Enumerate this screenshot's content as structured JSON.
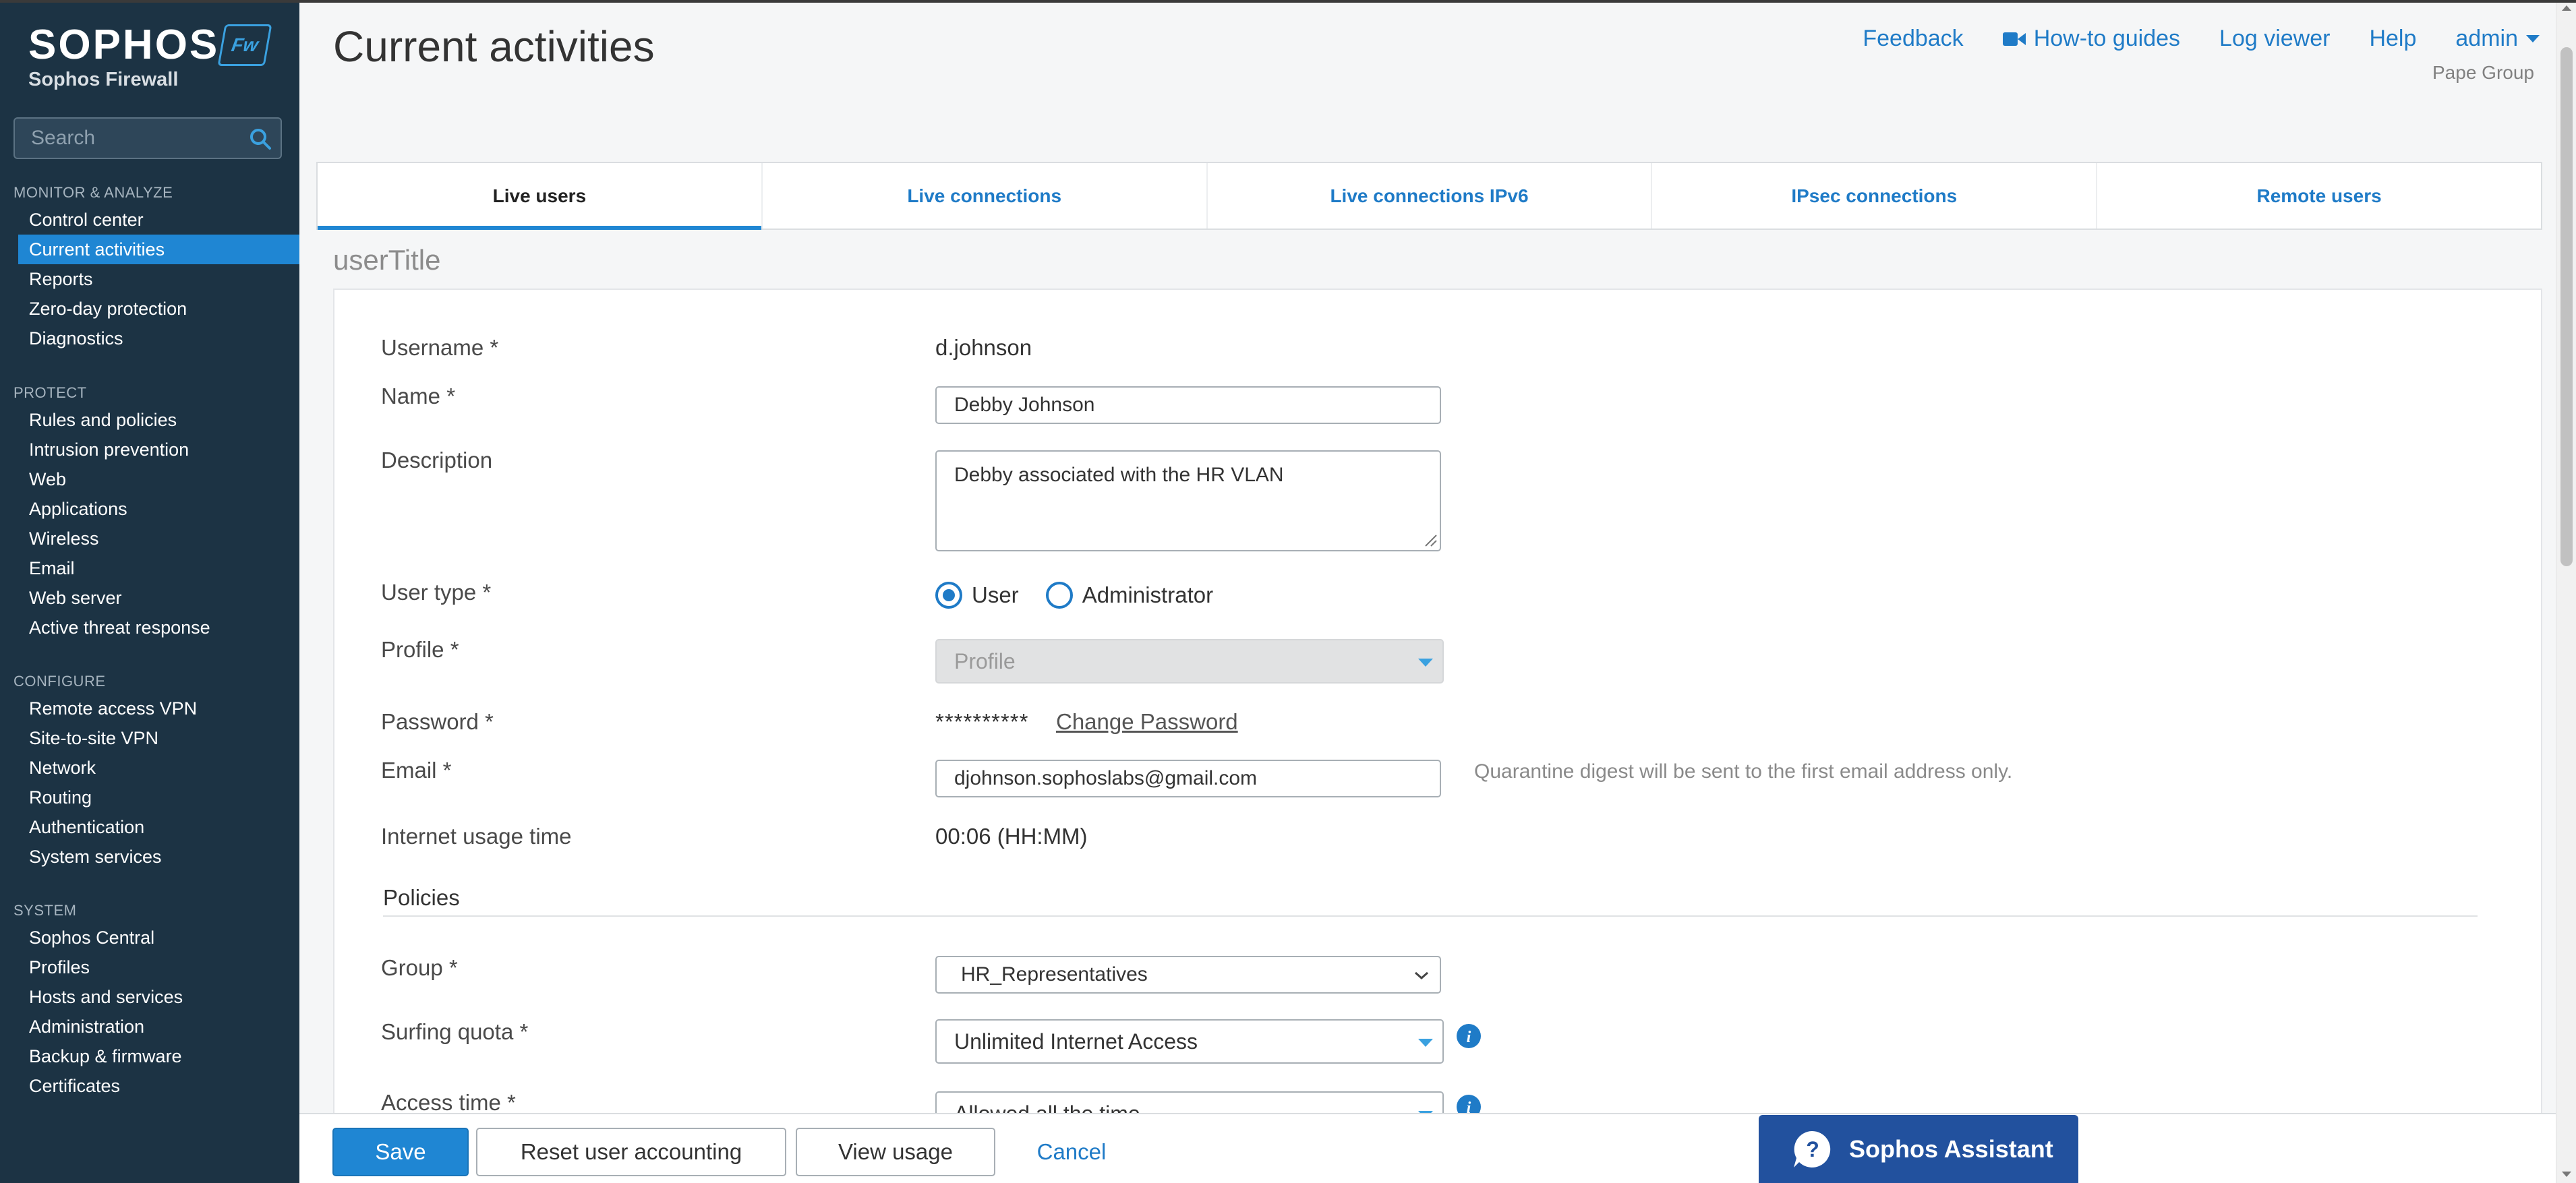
{
  "brand": {
    "name": "SOPHOS",
    "product": "Sophos Firewall",
    "badge": "Fw"
  },
  "search": {
    "placeholder": "Search"
  },
  "nav": {
    "monitor": {
      "heading": "MONITOR & ANALYZE",
      "items": [
        "Control center",
        "Current activities",
        "Reports",
        "Zero-day protection",
        "Diagnostics"
      ]
    },
    "protect": {
      "heading": "PROTECT",
      "items": [
        "Rules and policies",
        "Intrusion prevention",
        "Web",
        "Applications",
        "Wireless",
        "Email",
        "Web server",
        "Active threat response"
      ]
    },
    "configure": {
      "heading": "CONFIGURE",
      "items": [
        "Remote access VPN",
        "Site-to-site VPN",
        "Network",
        "Routing",
        "Authentication",
        "System services"
      ]
    },
    "system": {
      "heading": "SYSTEM",
      "items": [
        "Sophos Central",
        "Profiles",
        "Hosts and services",
        "Administration",
        "Backup & firmware",
        "Certificates"
      ]
    },
    "active_item": "Current activities"
  },
  "header": {
    "title": "Current activities",
    "links": {
      "feedback": "Feedback",
      "guides": "How-to guides",
      "log_viewer": "Log viewer",
      "help": "Help",
      "user": "admin"
    },
    "org": "Pape Group"
  },
  "tabs": [
    "Live users",
    "Live connections",
    "Live connections IPv6",
    "IPsec connections",
    "Remote users"
  ],
  "active_tab": "Live users",
  "form": {
    "title": "userTitle",
    "username": {
      "label": "Username *",
      "value": "d.johnson"
    },
    "name": {
      "label": "Name *",
      "value": "Debby Johnson"
    },
    "description": {
      "label": "Description",
      "value": "Debby associated with the HR VLAN"
    },
    "user_type": {
      "label": "User type *",
      "options": [
        "User",
        "Administrator"
      ],
      "selected": "User"
    },
    "profile": {
      "label": "Profile *",
      "placeholder": "Profile"
    },
    "password": {
      "label": "Password *",
      "masked": "**********",
      "change_link": "Change Password"
    },
    "email": {
      "label": "Email *",
      "value": "djohnson.sophoslabs@gmail.com",
      "hint": "Quarantine digest will be sent to the first email address only."
    },
    "internet_usage": {
      "label": "Internet usage time",
      "value": "00:06 (HH:MM)"
    },
    "policies_heading": "Policies",
    "group": {
      "label": "Group *",
      "value": "HR_Representatives"
    },
    "surfing_quota": {
      "label": "Surfing quota *",
      "value": "Unlimited Internet Access"
    },
    "access_time": {
      "label": "Access time *",
      "value": "Allowed all the time"
    }
  },
  "footer": {
    "save": "Save",
    "reset": "Reset user accounting",
    "view_usage": "View usage",
    "cancel": "Cancel"
  },
  "assistant": {
    "label": "Sophos Assistant"
  },
  "colors": {
    "sidebar": "#1c3344",
    "accent": "#1f86d3",
    "link": "#1f7bc7",
    "assistant": "#22519e"
  }
}
